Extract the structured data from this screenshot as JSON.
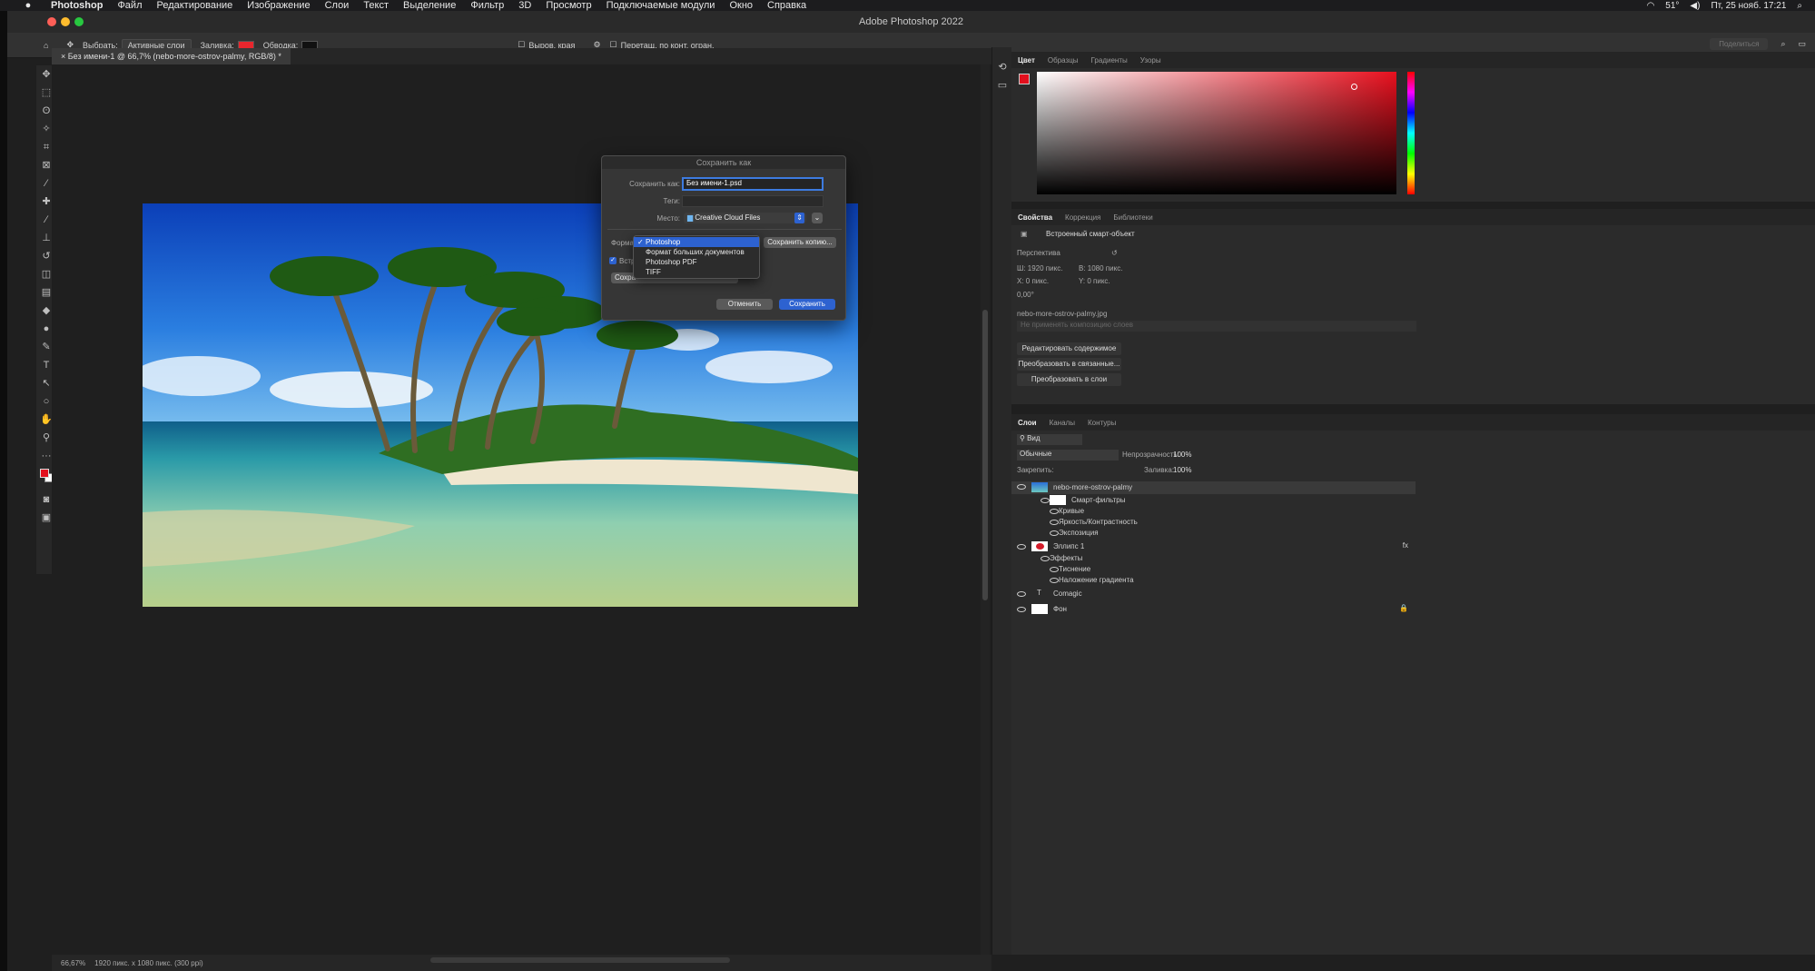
{
  "menubar": {
    "app": "Photoshop",
    "items": [
      "Файл",
      "Редактирование",
      "Изображение",
      "Слои",
      "Текст",
      "Выделение",
      "Фильтр",
      "3D",
      "Просмотр",
      "Подключаемые модули",
      "Окно",
      "Справка"
    ],
    "temperature": "51°",
    "datetime": "Пт, 25 нояб.  17:21"
  },
  "window": {
    "title": "Adobe Photoshop 2022"
  },
  "options": {
    "select_label": "Выбрать:",
    "select_value": "Активные слои",
    "fill_label": "Заливка:",
    "stroke_label": "Обводка:",
    "align_edges": "Выров. края",
    "constrain": "Перетащ. по конт. огран.",
    "share_button": "Поделиться",
    "fill_color": "#e8262d"
  },
  "doc_tab": {
    "label": "Без имени-1 @ 66,7% (nebo-more-ostrov-palmy, RGB/8) *"
  },
  "status": {
    "zoom": "66,67%",
    "info": "1920 пикс. x 1080 пикс. (300 ppi)"
  },
  "dialog": {
    "title": "Сохранить как",
    "save_as_label": "Сохранить как:",
    "save_as_value": "Без имени-1.psd",
    "tags_label": "Теги:",
    "location_label": "Место:",
    "location_value": "Creative Cloud Files",
    "format_label": "Форма",
    "embed_partial": "Встр",
    "save_copy_button": "Сохранить копию...",
    "partial_button": "Сохра",
    "cancel_button": "Отменить",
    "save_button": "Сохранить",
    "format_options": [
      "Photoshop",
      "Формат больших документов",
      "Photoshop PDF",
      "TIFF"
    ],
    "selected_format": "Photoshop"
  },
  "color_panel": {
    "tabs": [
      "Цвет",
      "Образцы",
      "Градиенты",
      "Узоры"
    ],
    "hue": "#e8101e"
  },
  "properties": {
    "tabs": [
      "Свойства",
      "Коррекция",
      "Библиотеки"
    ],
    "object_type": "Встроенный смарт-объект",
    "perspective": "Перспектива",
    "w": "Ш: 1920 пикс.",
    "h": "В: 1080 пикс.",
    "x": "X:  0 пикс.",
    "y": "Y:  0 пикс.",
    "angle": "0,00°",
    "file": "nebo-more-ostrov-palmy.jpg",
    "comp": "Не применять композицию слоев",
    "buttons": [
      "Редактировать содержимое",
      "Преобразовать в связанные...",
      "Преобразовать в слои"
    ]
  },
  "layers": {
    "tabs": [
      "Слои",
      "Каналы",
      "Контуры"
    ],
    "search": "Вид",
    "blend_mode": "Обычные",
    "opacity_label": "Непрозрачность:",
    "opacity_value": "100%",
    "lock_label": "Закрепить:",
    "fill_label": "Заливка:",
    "fill_value": "100%",
    "rows": [
      "nebo-more-ostrov-palmy",
      "Смарт-фильтры",
      "Кривые",
      "Яркость/Контрастность",
      "Экспозиция",
      "Эллипс 1",
      "Эффекты",
      "Тиснение",
      "Наложение градиента",
      "Comagic",
      "Фон"
    ]
  }
}
